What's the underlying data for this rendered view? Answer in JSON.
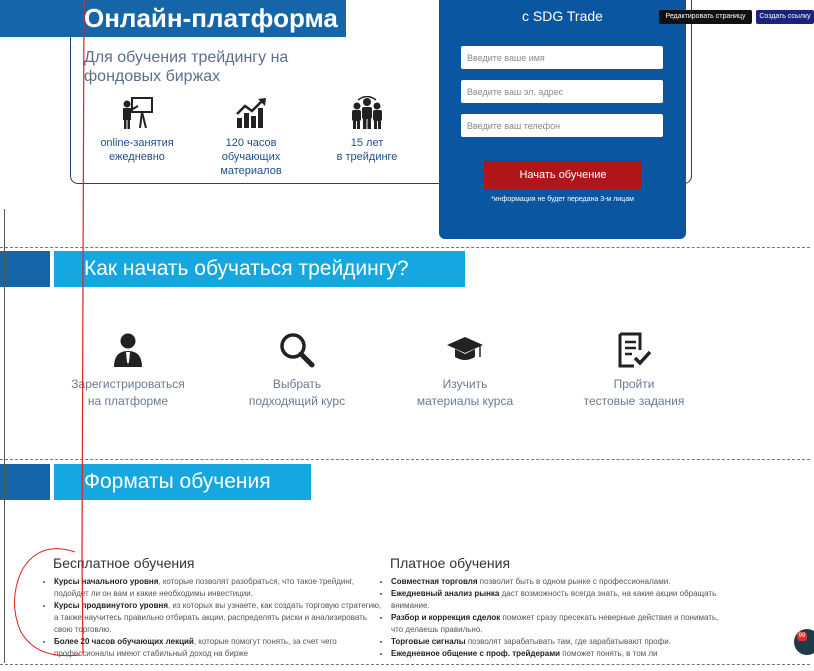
{
  "hero": {
    "title": "Онлайн-платформа",
    "subtitle": "Для обучения трейдингу на фондовых биржах",
    "features": [
      {
        "icon": "presentation-icon",
        "line1": "online-занятия",
        "line2": "ежедневно"
      },
      {
        "icon": "growth-chart-icon",
        "line1": "120 часов",
        "line2": "обучающих материалов"
      },
      {
        "icon": "group-icon",
        "line1": "15 лет",
        "line2": "в трейдинге"
      }
    ]
  },
  "form": {
    "title": "с SDG Trade",
    "name_placeholder": "Введите ваше имя",
    "email_placeholder": "Введите ваш эл. адрес",
    "phone_placeholder": "Введите ваш телефон",
    "submit_label": "Начать обучение",
    "note": "*информация не будет передана 3-м лицам"
  },
  "toolbar": {
    "edit_page": "Редактировать страницу",
    "create_link": "Создать ссылку"
  },
  "how_to": {
    "title": "Как начать обучаться трейдингу?",
    "steps": [
      {
        "icon": "user-icon",
        "line1": "Зарегистрироваться",
        "line2": "на платформе"
      },
      {
        "icon": "search-icon",
        "line1": "Выбрать",
        "line2": "подходящий курс"
      },
      {
        "icon": "graduation-cap-icon",
        "line1": "Изучить",
        "line2": "материалы курса"
      },
      {
        "icon": "checklist-icon",
        "line1": "Пройти",
        "line2": "тестовые задания"
      }
    ]
  },
  "formats": {
    "title": "Форматы обучения",
    "free": {
      "title": "Бесплатное обучения",
      "items": [
        {
          "bold": "Курсы начального уровня",
          "text": ", которые позволят разобраться, что такое трейдинг, подойдет ли он вам и какие необходимы инвестиции."
        },
        {
          "bold": "Курсы продвинутого уровня",
          "text": ", из которых вы узнаете, как создать торговую стратегию, а также научитесь правильно отбирать акции, распределять риски и анализировать свою торговлю."
        },
        {
          "bold": "Более 20 часов обучающих лекций",
          "text": ", которые помогут понять, за счет чего профессионалы имеют стабильный доход на бирже"
        }
      ]
    },
    "paid": {
      "title": "Платное обучения",
      "items": [
        {
          "bold": "Совместная торговля",
          "text": " позволит быть в одном рынке с профессионалами."
        },
        {
          "bold": "Ежедневный анализ рынка",
          "text": " даст возможность всегда знать, на какие акции обращать внимание."
        },
        {
          "bold": "Разбор и коррекция сделок",
          "text": " поможет сразу пресекать неверные действия и понимать, что делаешь правильно."
        },
        {
          "bold": "Торговые сигналы",
          "text": " позволят зарабатывать там, где зарабатывают профи."
        },
        {
          "bold": "Ежедневное общение с проф. трейдерами",
          "text": " поможет понять, в том ли"
        }
      ]
    }
  },
  "chat": {
    "badge": "99"
  },
  "colors": {
    "brand_dark": "#1565a8",
    "brand_light": "#17a7e0",
    "cta": "#b0151a",
    "form_bg": "#0a56a0"
  }
}
